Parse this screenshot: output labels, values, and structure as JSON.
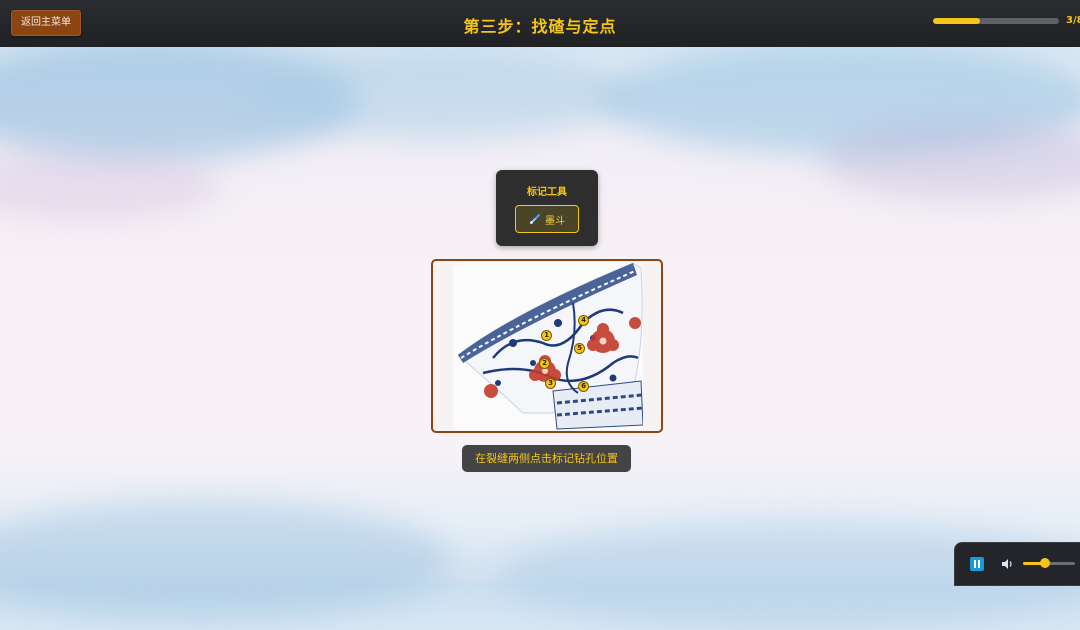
{
  "header": {
    "back_label": "返回主菜单",
    "title": "第三步：找碴与定点",
    "progress_text": "3/8",
    "progress_fraction": 0.375
  },
  "tool_panel": {
    "title": "标记工具",
    "tool_label": "墨斗",
    "tool_icon": "brush-icon"
  },
  "markers": [
    "1",
    "2",
    "3",
    "4",
    "5",
    "6"
  ],
  "hint": "在裂缝两侧点击标记钻孔位置",
  "audio": {
    "volume_fraction": 0.42
  },
  "colors": {
    "accent": "#f5c518",
    "back_button": "#8b4513",
    "frame_border": "#8b4513",
    "panel_bg": "#2e2e2e",
    "pause_button": "#1a9bd7"
  }
}
